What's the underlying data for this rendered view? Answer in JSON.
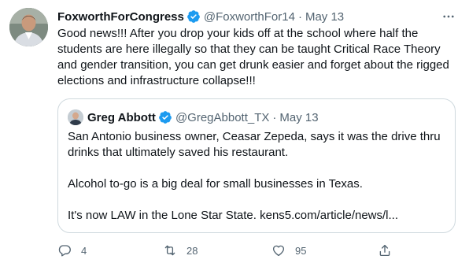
{
  "tweet": {
    "author_name": "FoxworthForCongress",
    "author_handle": "@FoxworthFor14",
    "separator": "·",
    "date": "May 13",
    "text": "Good news!!! After you drop your kids off at the school where half the students are here illegally so that they can be taught Critical Race Theory and gender transition, you can get drunk easier and forget about the rigged elections and infrastructure collapse!!!"
  },
  "quoted_tweet": {
    "author_name": "Greg Abbott",
    "author_handle": "@GregAbbott_TX",
    "separator": "·",
    "date": "May 13",
    "paragraphs": [
      "San Antonio business owner, Ceasar Zepeda, says it was the drive thru drinks that ultimately saved his restaurant.",
      "Alcohol to-go is a big deal for small businesses in Texas.",
      "It's now LAW in the Lone Star State. kens5.com/article/news/l..."
    ]
  },
  "actions": {
    "reply_count": "4",
    "retweet_count": "28",
    "like_count": "95"
  },
  "colors": {
    "verified_badge": "#1d9bf0",
    "secondary_text": "#536471",
    "border": "#cfd9de"
  },
  "icons": [
    "verified-badge-icon",
    "more-options-icon",
    "reply-icon",
    "retweet-icon",
    "like-icon",
    "share-icon"
  ]
}
